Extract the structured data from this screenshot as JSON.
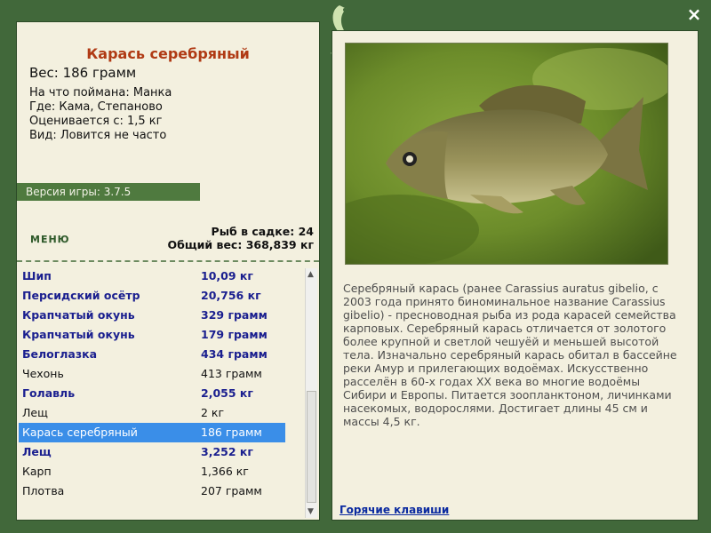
{
  "fish": {
    "title": "Карась серебряный",
    "weight": "Вес: 186 грамм",
    "caught_on": "На что поймана: Манка",
    "location": "Где: Кама, Степаново",
    "estimated": "Оценивается с: 1,5 кг",
    "kind": "Вид: Ловится не часто",
    "description": "Серебряный карась (ранее Carassius auratus gibelio, с 2003 года принято биноминальное название Carassius gibelio) - пресноводная рыба из рода карасей семейства карповых. Серебряный карась отличается от золотого более крупной и светлой чешуёй и меньшей высотой тела. Изначально серебряный карась обитал в бассейне реки Амур и прилегающих водоёмах. Искусственно расселён в 60-х годах XX века во многие водоёмы Сибири и Европы. Питается зоопланктоном, личинками насекомых, водорослями. Достигает длины 45 см и массы 4,5 кг."
  },
  "version": "Версия игры: 3.7.5",
  "menu_label": "МЕНЮ",
  "stats": {
    "count": "Рыб в садке: 24",
    "total": "Общий вес: 368,839 кг"
  },
  "catch_list": [
    {
      "name": "Шип",
      "weight": "10,09 кг",
      "style": "bold"
    },
    {
      "name": "Персидский осётр",
      "weight": "20,756 кг",
      "style": "bold"
    },
    {
      "name": "Крапчатый окунь",
      "weight": "329 грамм",
      "style": "bold"
    },
    {
      "name": "Крапчатый окунь",
      "weight": "179 грамм",
      "style": "bold"
    },
    {
      "name": "Белоглазка",
      "weight": "434 грамм",
      "style": "bold"
    },
    {
      "name": "Чехонь",
      "weight": "413 грамм",
      "style": "plain"
    },
    {
      "name": "Голавль",
      "weight": "2,055 кг",
      "style": "bold"
    },
    {
      "name": "Лещ",
      "weight": "2 кг",
      "style": "plain"
    },
    {
      "name": "Карась серебряный",
      "weight": "186 грамм",
      "style": "selected"
    },
    {
      "name": "Лещ",
      "weight": "3,252 кг",
      "style": "bold"
    },
    {
      "name": "Карп",
      "weight": "1,366 кг",
      "style": "plain"
    },
    {
      "name": "Плотва",
      "weight": "207 грамм",
      "style": "plain"
    }
  ],
  "hotkeys_label": "Горячие клавиши",
  "close_label": "×",
  "icons": {
    "close": "close-icon",
    "logo": "fish-logo-icon",
    "scroll_up": "scroll-up-icon",
    "scroll_down": "scroll-down-icon"
  },
  "colors": {
    "frame": "#41683a",
    "panel": "#f3f0df",
    "title": "#b03a14",
    "bold_item": "#1a1f8f",
    "selected": "#3a8ee8",
    "link": "#0b2aa0"
  }
}
